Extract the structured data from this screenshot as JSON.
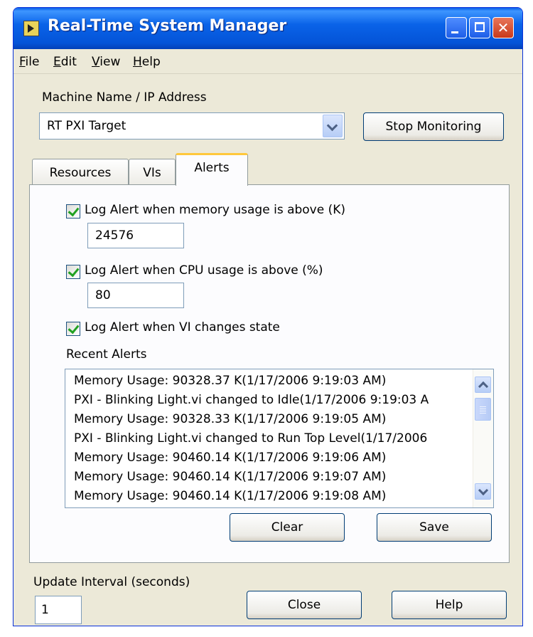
{
  "window": {
    "title": "Real-Time System Manager"
  },
  "menu": {
    "items": [
      "File",
      "Edit",
      "View",
      "Help"
    ]
  },
  "machine": {
    "label": "Machine Name / IP Address",
    "value": "RT PXI Target",
    "stop_button": "Stop Monitoring"
  },
  "tabs": [
    "Resources",
    "VIs",
    "Alerts"
  ],
  "active_tab": "Alerts",
  "alerts_tab": {
    "memory": {
      "label": "Log Alert when memory usage is above (K)",
      "checked": true,
      "value": "24576"
    },
    "cpu": {
      "label": "Log Alert when CPU usage is above (%)",
      "checked": true,
      "value": "80"
    },
    "vi_state": {
      "label": "Log Alert when VI changes state",
      "checked": true
    },
    "recent_label": "Recent Alerts",
    "recent": [
      "Memory Usage: 90328.37 K(1/17/2006 9:19:03 AM)",
      "PXI - Blinking Light.vi changed to Idle(1/17/2006 9:19:03 A",
      "Memory Usage: 90328.33 K(1/17/2006 9:19:05 AM)",
      "PXI - Blinking Light.vi changed to Run Top Level(1/17/2006",
      "Memory Usage: 90460.14 K(1/17/2006 9:19:06 AM)",
      "Memory Usage: 90460.14 K(1/17/2006 9:19:07 AM)",
      "Memory Usage: 90460.14 K(1/17/2006 9:19:08 AM)"
    ],
    "clear_button": "Clear",
    "save_button": "Save"
  },
  "update": {
    "label": "Update Interval (seconds)",
    "value": "1"
  },
  "footer": {
    "close_button": "Close",
    "help_button": "Help"
  },
  "colors": {
    "titlebar": "#0a5fe8",
    "window_bg": "#ece9d8",
    "tab_highlight": "#ffc83c",
    "checkmark": "#21a121"
  }
}
